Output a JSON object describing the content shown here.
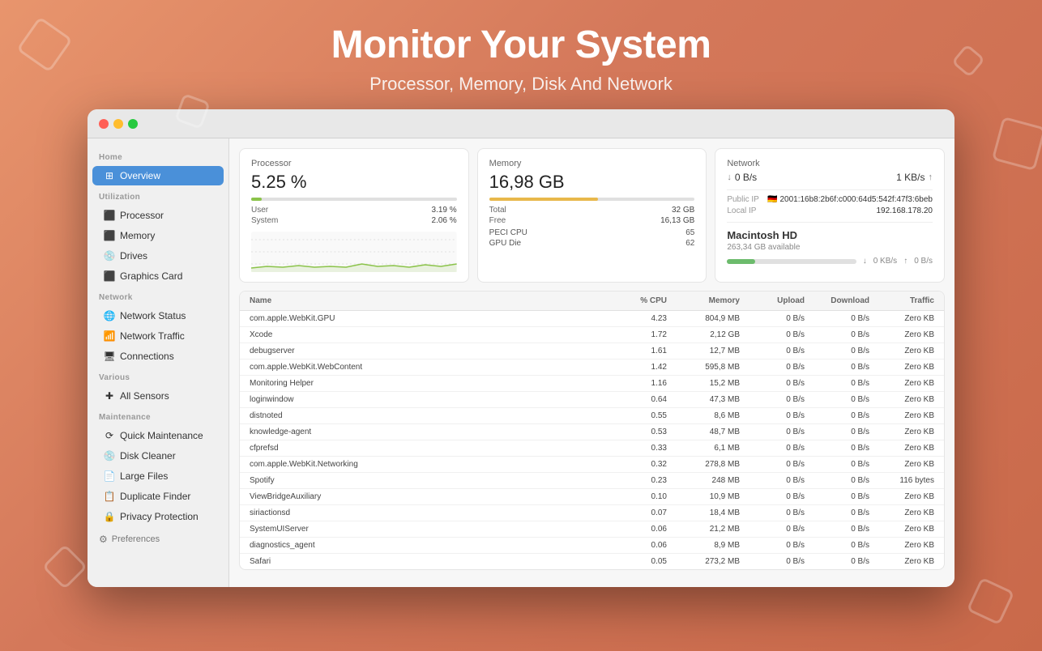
{
  "header": {
    "title": "Monitor Your System",
    "subtitle": "Processor, Memory, Disk And Network"
  },
  "sidebar": {
    "home_label": "Home",
    "overview_label": "Overview",
    "utilization_label": "Utilization",
    "processor_label": "Processor",
    "memory_label": "Memory",
    "drives_label": "Drives",
    "graphics_card_label": "Graphics Card",
    "network_label": "Network",
    "network_status_label": "Network Status",
    "network_traffic_label": "Network Traffic",
    "connections_label": "Connections",
    "various_label": "Various",
    "all_sensors_label": "All Sensors",
    "maintenance_label": "Maintenance",
    "quick_maintenance_label": "Quick Maintenance",
    "disk_cleaner_label": "Disk Cleaner",
    "large_files_label": "Large Files",
    "duplicate_finder_label": "Duplicate Finder",
    "privacy_protection_label": "Privacy Protection",
    "preferences_label": "Preferences"
  },
  "processor": {
    "title": "Processor",
    "value": "5.25 %",
    "user_label": "User",
    "user_value": "3.19 %",
    "system_label": "System",
    "system_value": "2.06 %",
    "progress": 5.25
  },
  "memory": {
    "title": "Memory",
    "value": "16,98 GB",
    "total_label": "Total",
    "total_value": "32 GB",
    "free_label": "Free",
    "free_value": "16,13 GB",
    "progress": 53
  },
  "network": {
    "title": "Network",
    "down_label": "0 B/s",
    "up_label": "1 KB/s",
    "public_ip_label": "Public IP",
    "public_ip_value": "🇩🇪 2001:16b8:2b6f:c000:64d5:542f:47f3:6beb",
    "local_ip_label": "Local IP",
    "local_ip_value": "192.168.178.20"
  },
  "gpu": {
    "peci_cpu_label": "PECI CPU",
    "peci_cpu_value": "65",
    "gpu_die_label": "GPU Die",
    "gpu_die_value": "62"
  },
  "disk": {
    "title": "Macintosh HD",
    "available": "263,34 GB available",
    "read_label": "0 KB/s",
    "write_label": "0 B/s",
    "fill_percent": 22
  },
  "table": {
    "columns": [
      "Name",
      "% CPU",
      "Memory",
      "Upload",
      "Download",
      "Traffic"
    ],
    "rows": [
      [
        "com.apple.WebKit.GPU",
        "4.23",
        "804,9 MB",
        "0 B/s",
        "0 B/s",
        "Zero KB"
      ],
      [
        "Xcode",
        "1.72",
        "2,12 GB",
        "0 B/s",
        "0 B/s",
        "Zero KB"
      ],
      [
        "debugserver",
        "1.61",
        "12,7 MB",
        "0 B/s",
        "0 B/s",
        "Zero KB"
      ],
      [
        "com.apple.WebKit.WebContent",
        "1.42",
        "595,8 MB",
        "0 B/s",
        "0 B/s",
        "Zero KB"
      ],
      [
        "Monitoring Helper",
        "1.16",
        "15,2 MB",
        "0 B/s",
        "0 B/s",
        "Zero KB"
      ],
      [
        "loginwindow",
        "0.64",
        "47,3 MB",
        "0 B/s",
        "0 B/s",
        "Zero KB"
      ],
      [
        "distnoted",
        "0.55",
        "8,6 MB",
        "0 B/s",
        "0 B/s",
        "Zero KB"
      ],
      [
        "knowledge-agent",
        "0.53",
        "48,7 MB",
        "0 B/s",
        "0 B/s",
        "Zero KB"
      ],
      [
        "cfprefsd",
        "0.33",
        "6,1 MB",
        "0 B/s",
        "0 B/s",
        "Zero KB"
      ],
      [
        "com.apple.WebKit.Networking",
        "0.32",
        "278,8 MB",
        "0 B/s",
        "0 B/s",
        "Zero KB"
      ],
      [
        "Spotify",
        "0.23",
        "248 MB",
        "0 B/s",
        "0 B/s",
        "116 bytes"
      ],
      [
        "ViewBridgeAuxiliary",
        "0.10",
        "10,9 MB",
        "0 B/s",
        "0 B/s",
        "Zero KB"
      ],
      [
        "siriactionsd",
        "0.07",
        "18,4 MB",
        "0 B/s",
        "0 B/s",
        "Zero KB"
      ],
      [
        "SystemUIServer",
        "0.06",
        "21,2 MB",
        "0 B/s",
        "0 B/s",
        "Zero KB"
      ],
      [
        "diagnostics_agent",
        "0.06",
        "8,9 MB",
        "0 B/s",
        "0 B/s",
        "Zero KB"
      ],
      [
        "Safari",
        "0.05",
        "273,2 MB",
        "0 B/s",
        "0 B/s",
        "Zero KB"
      ]
    ]
  }
}
